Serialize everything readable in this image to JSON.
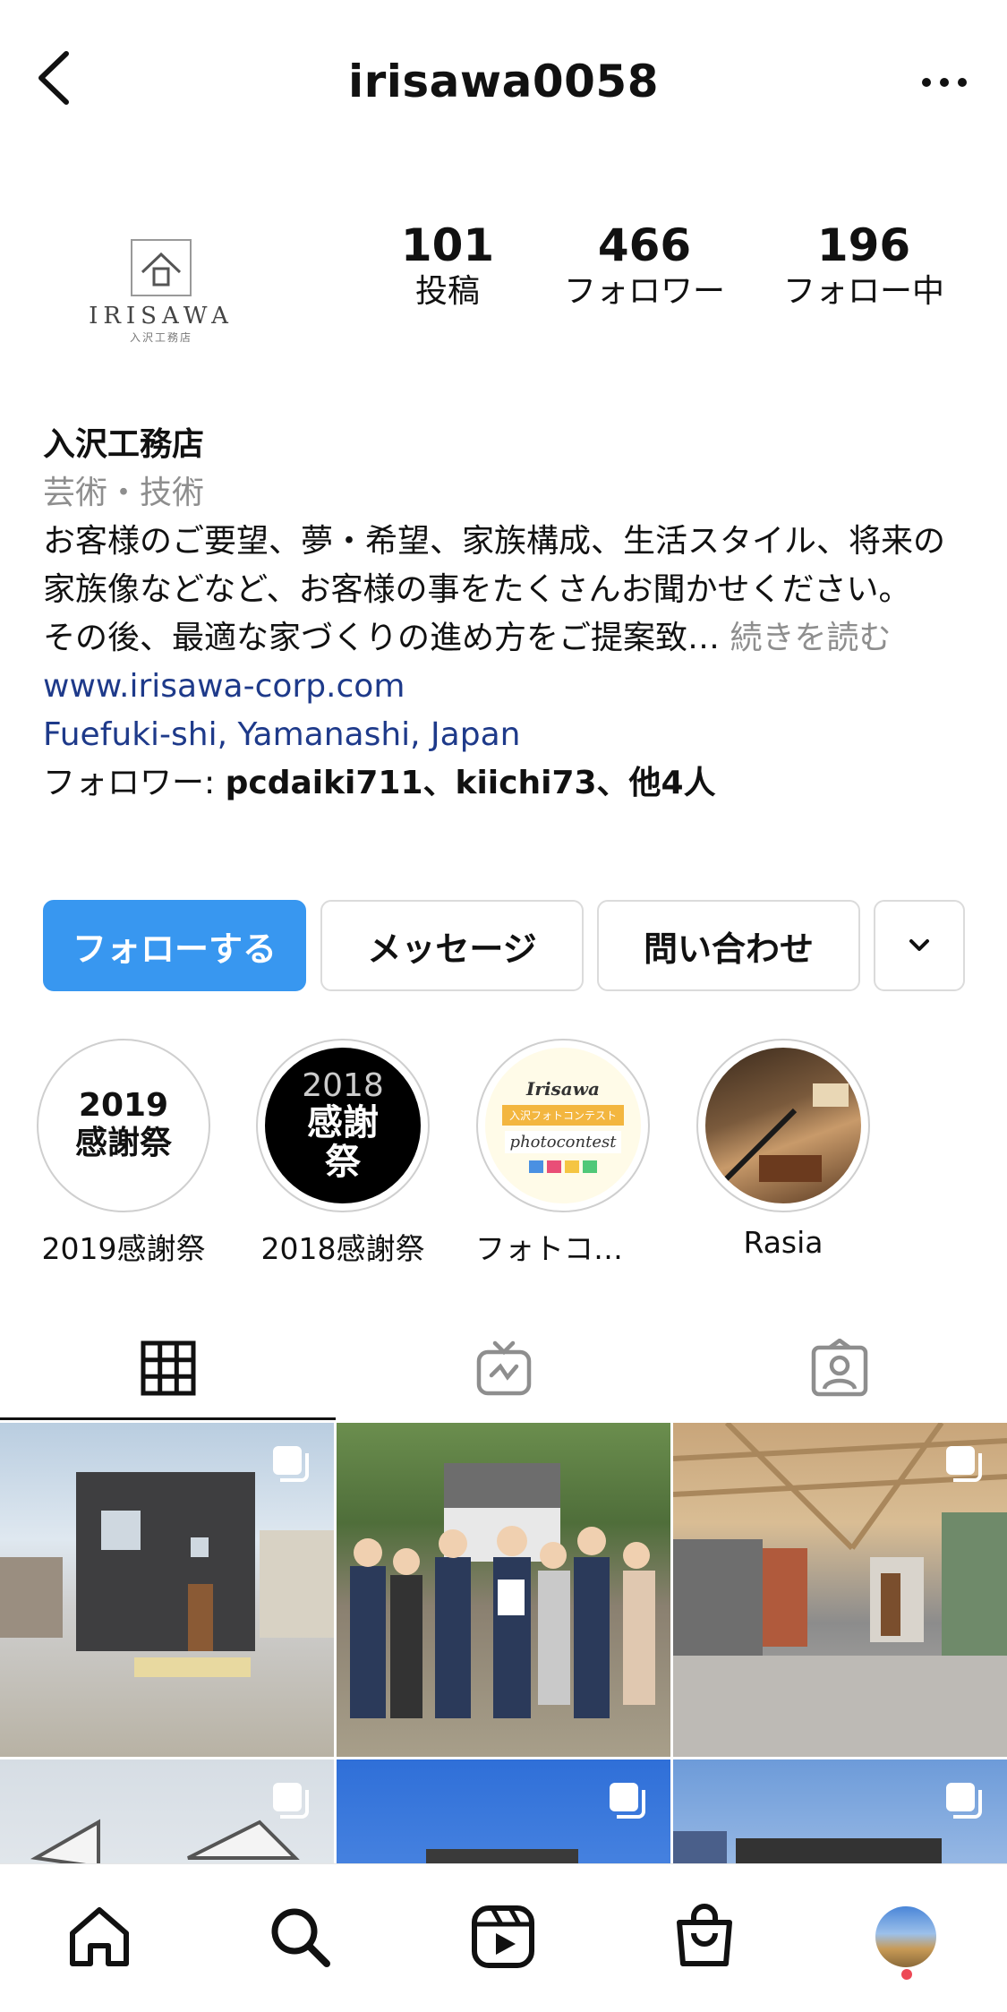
{
  "header": {
    "username": "irisawa0058"
  },
  "avatar": {
    "logo_text": "IRISAWA",
    "logo_sub": "入沢工務店"
  },
  "stats": [
    {
      "num": "101",
      "label": "投稿"
    },
    {
      "num": "466",
      "label": "フォロワー"
    },
    {
      "num": "196",
      "label": "フォロー中"
    }
  ],
  "bio": {
    "name": "入沢工務店",
    "category": "芸術・技術",
    "text1": "お客様のご要望、夢・希望、家族構成、生活スタイル、将来の家族像などなど、お客様の事をたくさんお聞かせください。",
    "text2": "その後、最適な家づくりの進め方をご提案致…",
    "more": "続きを読む",
    "website": "www.irisawa-corp.com",
    "location": "Fuefuki-shi, Yamanashi, Japan",
    "followed_prefix": "フォロワー: ",
    "followed_names": "pcdaiki711、kiichi73、他4人"
  },
  "actions": {
    "follow": "フォローする",
    "message": "メッセージ",
    "contact": "問い合わせ"
  },
  "highlights": [
    {
      "label": "2019感謝祭",
      "cover_line1": "2019",
      "cover_line2": "感謝祭"
    },
    {
      "label": "2018感謝祭",
      "cover_line1": "2018",
      "cover_line2": "感謝",
      "cover_line3": "祭"
    },
    {
      "label": "フォトコンテ…",
      "cover_line1": "Irisawa",
      "cover_line2": "入沢フォトコンテスト",
      "cover_line3": "photocontest"
    },
    {
      "label": "Rasia"
    }
  ],
  "colors": {
    "accent": "#3897f0",
    "link": "#1e3a8a",
    "muted": "#8e8e8e",
    "notification": "#ed4956"
  }
}
